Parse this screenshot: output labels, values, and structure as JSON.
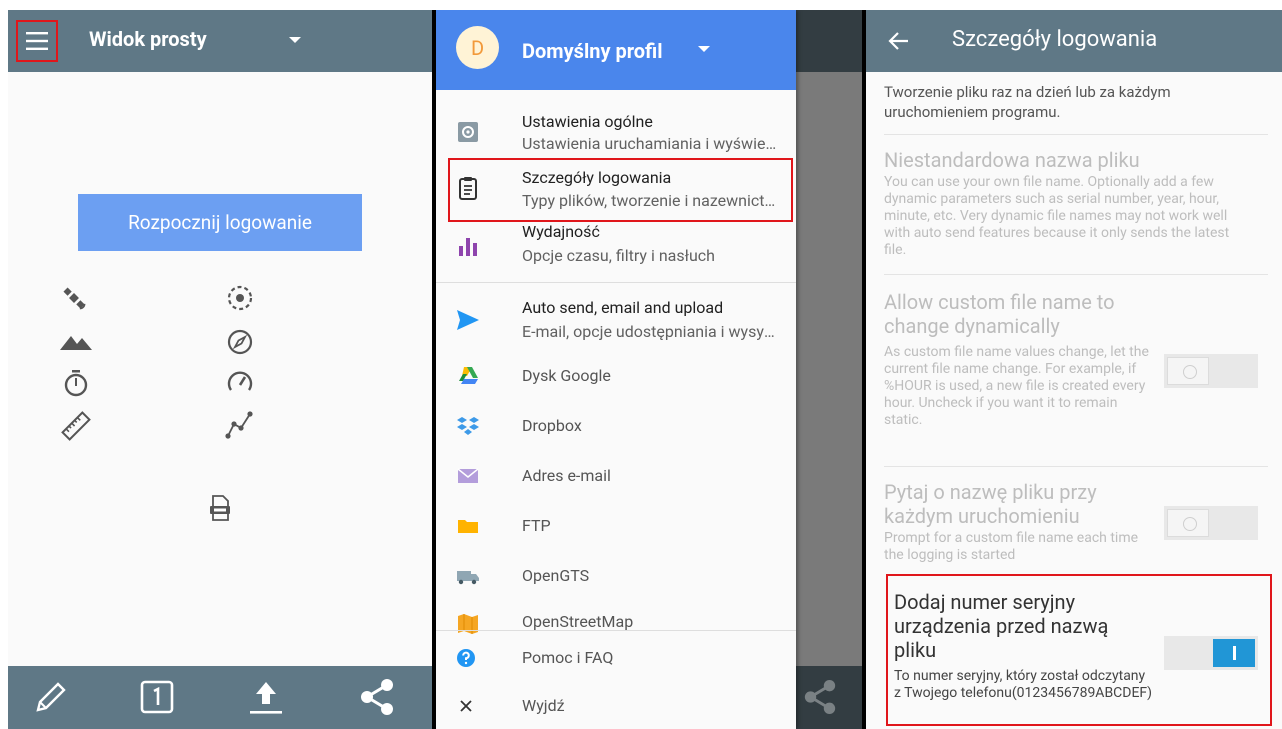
{
  "panel1": {
    "title": "Widok prosty",
    "start_button": "Rozpocznij logowanie",
    "status_icons": [
      "satellite-icon",
      "gps-fix-icon",
      "altitude-icon",
      "compass-icon",
      "timer-icon",
      "speedometer-icon",
      "distance-ruler-icon",
      "track-points-icon"
    ],
    "file_icon": "log-file-icon",
    "bottom_icons": [
      "pencil-icon",
      "single-point-icon",
      "upload-icon",
      "share-icon"
    ]
  },
  "panel2": {
    "avatar_letter": "D",
    "profile_name": "Domyślny profil",
    "items": [
      {
        "title": "Ustawienia ogólne",
        "subtitle": "Ustawienia uruchamiania i wyświetlania",
        "icon": "settings-icon"
      },
      {
        "title": "Szczegóły logowania",
        "subtitle": "Typy plików, tworzenie i nazewnictwo",
        "icon": "clipboard-icon"
      },
      {
        "title": "Wydajność",
        "subtitle": "Opcje czasu, filtry i nasłuch",
        "icon": "bar-chart-icon"
      },
      {
        "title": "Auto send, email and upload",
        "subtitle": "E-mail, opcje udostępniania i wysyłania",
        "icon": "send-icon"
      },
      {
        "title": "Dysk Google",
        "icon": "google-drive-icon"
      },
      {
        "title": "Dropbox",
        "icon": "dropbox-icon"
      },
      {
        "title": "Adres e-mail",
        "icon": "email-icon"
      },
      {
        "title": "FTP",
        "icon": "folder-icon"
      },
      {
        "title": "OpenGTS",
        "icon": "truck-icon"
      },
      {
        "title": "OpenStreetMap",
        "icon": "map-icon"
      },
      {
        "title": "Pomoc i FAQ",
        "icon": "help-icon"
      },
      {
        "title": "Wyjdź",
        "icon": "close-icon"
      }
    ]
  },
  "panel3": {
    "title": "Szczegóły logowania",
    "top_text": "Tworzenie pliku raz na dzień lub za każdym uruchomieniem programu.",
    "custom_name_title": "Niestandardowa nazwa pliku",
    "custom_name_desc": "You can use your own file name. Optionally add a few dynamic parameters such as serial number, year, hour, minute, etc. Very dynamic file names may not work well with auto send features because it only sends the latest file.",
    "dynamic_title": "Allow custom file name to change dynamically",
    "dynamic_desc": "As custom file name values change, let the current file name change. For example, if %HOUR is used, a new file is created every hour. Uncheck if you want it to remain static.",
    "ask_title": "Pytaj o nazwę pliku przy każdym uruchomieniu",
    "ask_desc": "Prompt for a custom file name each time the logging is started",
    "serial_title": "Dodaj numer seryjny urządzenia przed nazwą pliku",
    "serial_desc": "To numer seryjny, który został odczytany z Twojego telefonu(0123456789ABCDEF)",
    "toggles": {
      "dynamic": false,
      "ask": false,
      "serial": true
    }
  }
}
